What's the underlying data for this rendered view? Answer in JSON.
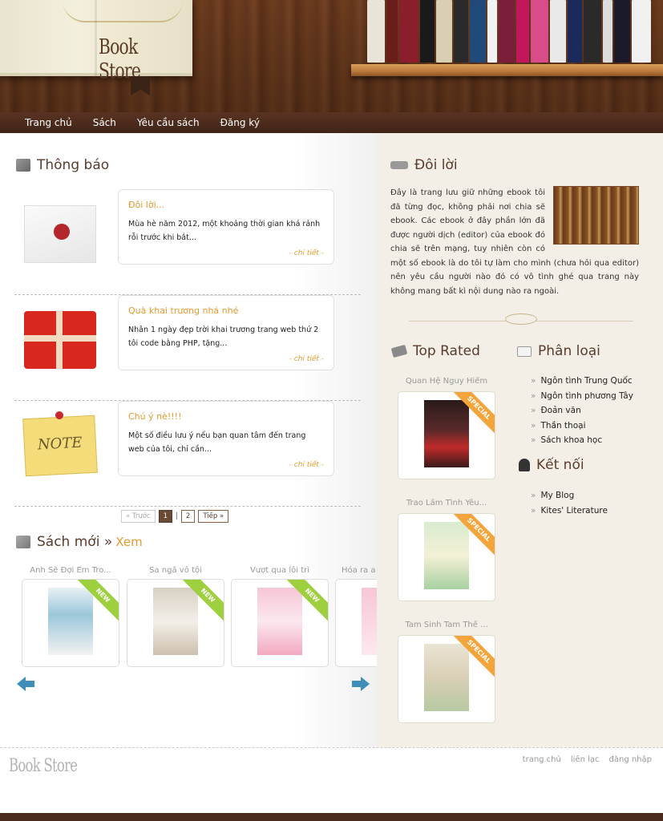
{
  "logo": {
    "text": "Book Store"
  },
  "nav": {
    "items": [
      "Trang chủ",
      "Sách",
      "Yêu cầu sách",
      "Đăng ký"
    ]
  },
  "notices": {
    "title": "Thông báo",
    "items": [
      {
        "title": "Đôi lời...",
        "body": "Mùa hè năm 2012, một khoảng thời gian khá rảnh rỗi trước khi bắt...",
        "more": "- chi tiết -",
        "icon": "envelope-icon"
      },
      {
        "title": "Quà khai trương nhá nhé",
        "body": "Nhân 1 ngày đẹp trời khai trương trang web thứ 2 tôi code bằng PHP, tặng...",
        "more": "- chi tiết -",
        "icon": "gift-icon"
      },
      {
        "title": "Chú ý nè!!!!",
        "body": "Một số điều lưu ý nếu bạn quan tâm đến trang web của tôi, chỉ cần...",
        "more": "- chi tiết -",
        "icon": "note-icon"
      }
    ]
  },
  "pager": {
    "prev": "« Trước",
    "pages": [
      "1",
      "2"
    ],
    "current": "1",
    "separator": "|",
    "next": "Tiếp »"
  },
  "new_books": {
    "title": "Sách mới »",
    "view_link": "Xem",
    "items": [
      {
        "title": "Anh Sẽ Đợi Em Tro...",
        "badge": "NEW"
      },
      {
        "title": "Sa ngã vô tội",
        "badge": "NEW"
      },
      {
        "title": "Vượt qua lôi trì",
        "badge": "NEW"
      },
      {
        "title": "Hóa ra a",
        "badge": ""
      }
    ]
  },
  "intro": {
    "title": "Đôi lời",
    "text": "Đây là trang lưu giữ những ebook tôi đã từng đọc, không phải nơi chia sẽ ebook. Các ebook ở đây phần lớn đã được người dịch (editor) của ebook đó chia sẽ trên mạng, tuy nhiên còn có một số ebook là do tôi tự làm cho mình (chưa hỏi qua editor) nên yêu cầu người nào đó có vô tình ghé qua trang này không mang bất kì nội dung nào ra ngoài."
  },
  "top_rated": {
    "title": "Top Rated",
    "items": [
      {
        "title": "Quan Hệ Nguy Hiểm",
        "badge": "SPECIAL"
      },
      {
        "title": "Trao Lầm Tình Yêu...",
        "badge": "SPECIAL"
      },
      {
        "title": "Tam Sinh Tam Thế ...",
        "badge": "SPECIAL"
      }
    ]
  },
  "categories": {
    "title": "Phân loại",
    "items": [
      "Ngôn tình Trung Quốc",
      "Ngôn tình phương Tây",
      "Đoản văn",
      "Thần thoại",
      "Sách khoa học"
    ]
  },
  "links": {
    "title": "Kết nối",
    "items": [
      "My Blog",
      "Kites' Literature"
    ]
  },
  "footer": {
    "logo": "Book Store",
    "links": [
      "trang chủ",
      "liên lạc",
      "đăng nhập"
    ]
  }
}
